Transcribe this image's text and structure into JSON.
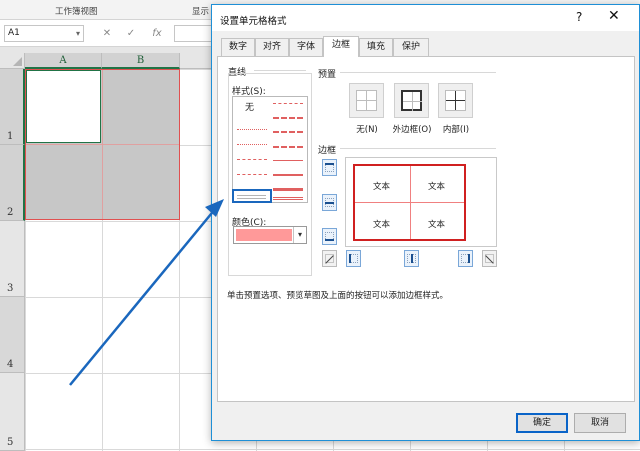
{
  "excel": {
    "ribbon_tabs": [
      "工作簿视图",
      "显示"
    ],
    "name_box": "A1",
    "formula_buttons": [
      "✕",
      "✓",
      "fx"
    ],
    "columns": [
      "A",
      "B"
    ],
    "rows": [
      "1",
      "2",
      "3",
      "4",
      "5"
    ]
  },
  "dialog": {
    "title": "设置单元格格式",
    "help": "?",
    "close": "✕",
    "tabs": [
      "数字",
      "对齐",
      "字体",
      "边框",
      "填充",
      "保护"
    ],
    "active_tab": "边框",
    "line_group": "直线",
    "style_label": "样式(S):",
    "style_none": "无",
    "color_label": "颜色(C):",
    "color_value": "#ff9999",
    "preset_group": "预置",
    "presets": [
      "无(N)",
      "外边框(O)",
      "内部(I)"
    ],
    "border_group": "边框",
    "preview_text": [
      "文本",
      "文本",
      "文本",
      "文本"
    ],
    "hint": "单击预置选项、预览草图及上面的按钮可以添加边框样式。",
    "ok": "确定",
    "cancel": "取消"
  },
  "colors": {
    "accent_blue": "#1a67bd",
    "border_red": "#d02020",
    "selection_green": "#217346"
  }
}
